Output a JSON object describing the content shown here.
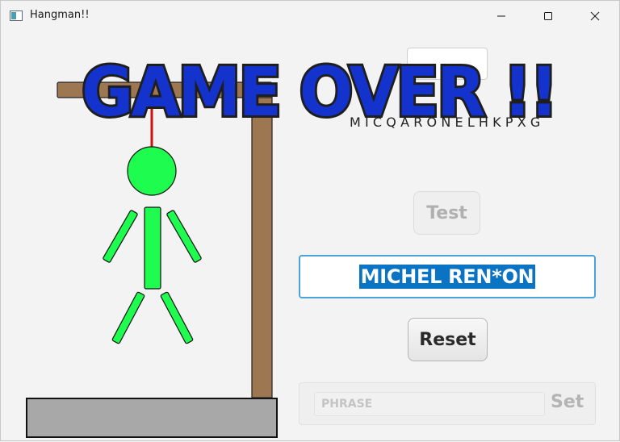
{
  "window": {
    "title": "Hangman!!"
  },
  "game": {
    "used_letters": "MICQARONELHKPXG",
    "phrase_display": "MICHEL REN*ON",
    "status_banner": "GAME OVER !!"
  },
  "controls": {
    "test_label": "Test",
    "reset_label": "Reset",
    "set_label": "Set",
    "phrase_placeholder": "PHRASE"
  },
  "colors": {
    "banner_fill": "#1433cc",
    "banner_outline": "#1e1e1e",
    "body_green": "#1dfc4f",
    "rope_red": "#cc1111",
    "wood_brown": "#9c7752",
    "ground_gray": "#a8a8a8",
    "highlight_blue": "#0b73c4"
  },
  "icons": {
    "app": "app-window-icon",
    "minimize": "minimize-icon",
    "maximize": "maximize-icon",
    "close": "close-icon"
  }
}
